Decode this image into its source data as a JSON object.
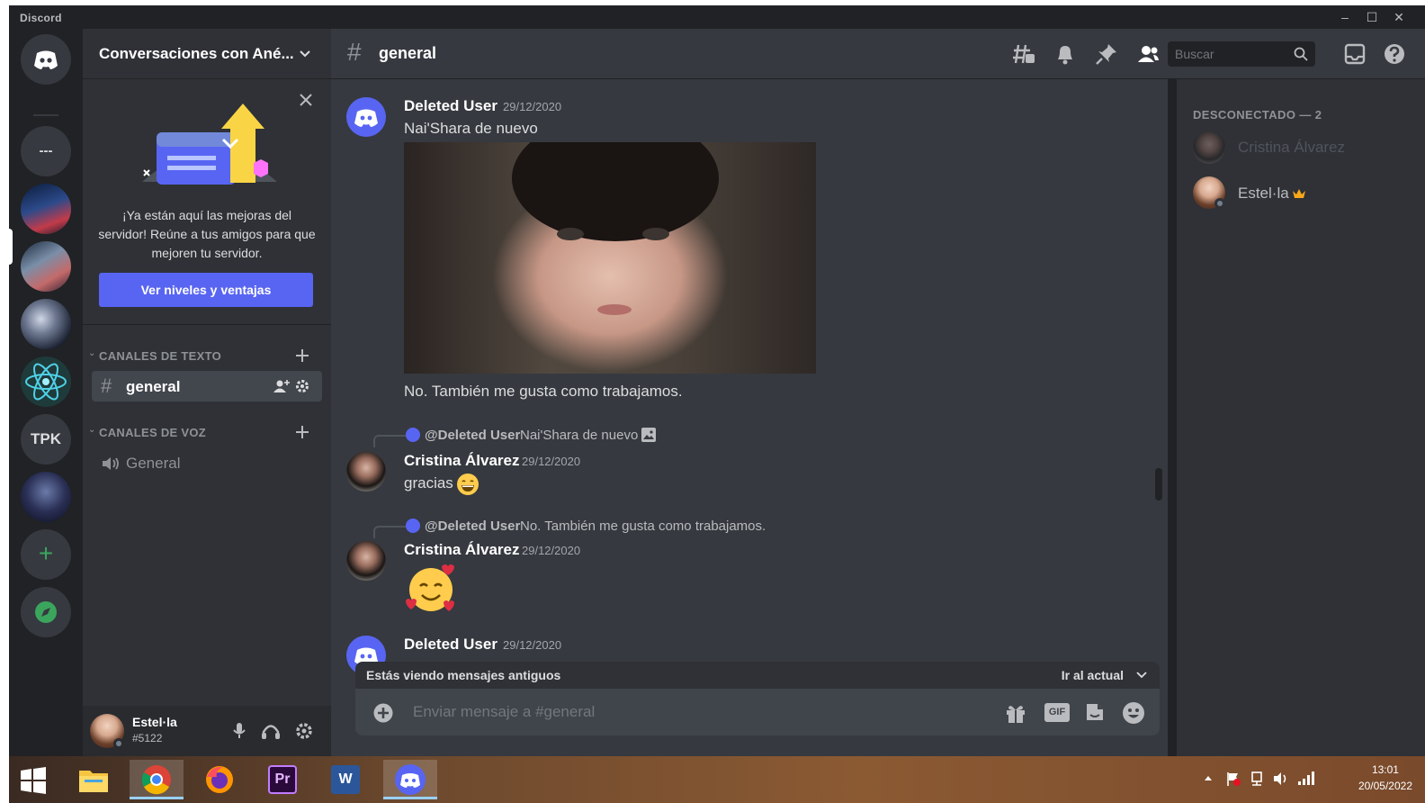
{
  "app": {
    "title": "Discord"
  },
  "window_controls": {
    "minimize": "–",
    "maximize": "☐",
    "close": "✕"
  },
  "servers": {
    "dots_label": "---",
    "tpk_label": "TPK",
    "add_label": "+"
  },
  "sidebar": {
    "server_name": "Conversaciones con Ané...",
    "promo": {
      "text": "¡Ya están aquí las mejoras del servidor! Reúne a tus amigos para que mejoren tu servidor.",
      "button": "Ver niveles y ventajas"
    },
    "text_category": "CANALES DE TEXTO",
    "voice_category": "CANALES DE VOZ",
    "text_channels": [
      {
        "label": "general"
      }
    ],
    "voice_channels": [
      {
        "label": "General"
      }
    ]
  },
  "user": {
    "name": "Estel·la",
    "tag": "#5122"
  },
  "channel_header": {
    "title": "general",
    "search_placeholder": "Buscar"
  },
  "messages": [
    {
      "author": "Deleted User",
      "time": "29/12/2020",
      "text": "Nai'Shara de nuevo"
    },
    {
      "text": "No.  También me gusta como trabajamos."
    },
    {
      "reply_mention": "@Deleted User",
      "reply_snippet": "Nai'Shara de nuevo",
      "author": "Cristina Álvarez",
      "time": "29/12/2020",
      "text": "gracias"
    },
    {
      "reply_mention": "@Deleted User",
      "reply_snippet": "No.  También me gusta como trabajamos.",
      "author": "Cristina Álvarez",
      "time": "29/12/2020"
    },
    {
      "author": "Deleted User",
      "time": "29/12/2020"
    }
  ],
  "old_messages_bar": {
    "text": "Estás viendo mensajes antiguos",
    "jump": "Ir al actual"
  },
  "composer": {
    "placeholder": "Enviar mensaje a #general",
    "gif_label": "GIF"
  },
  "members": {
    "category": "DESCONECTADO — 2",
    "list": [
      {
        "name": "Cristina Álvarez"
      },
      {
        "name": "Estel·la"
      }
    ]
  },
  "taskbar": {
    "time": "13:01",
    "date": "20/05/2022",
    "premiere_label": "Pr",
    "word_label": "W"
  },
  "colors": {
    "blurple": "#5865f2",
    "green": "#3ba55d",
    "bg_primary": "#36393f",
    "bg_secondary": "#2f3136",
    "bg_tertiary": "#202225"
  }
}
